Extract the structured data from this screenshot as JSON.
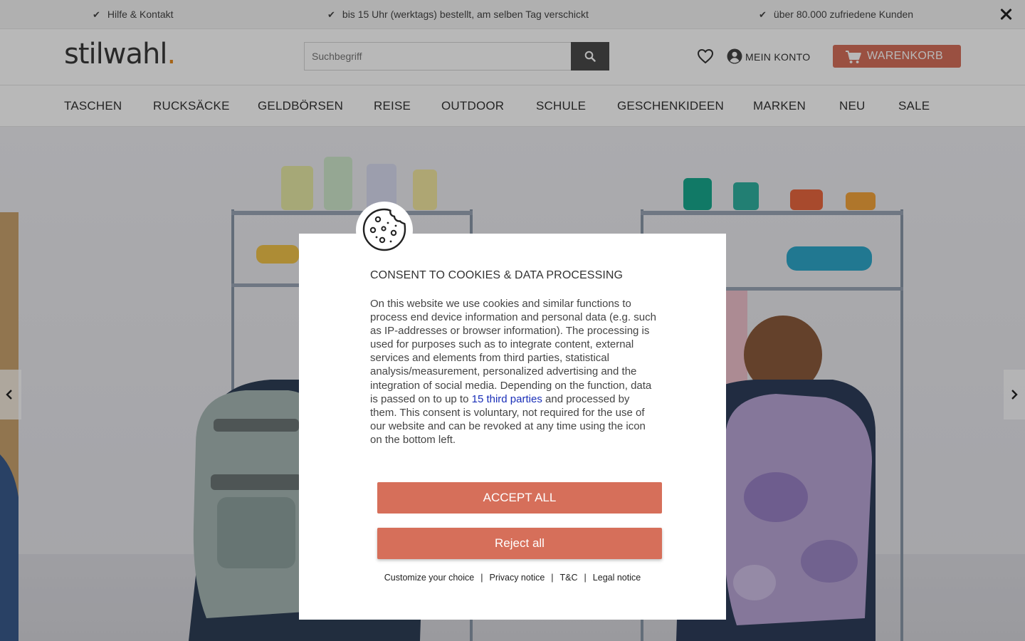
{
  "topbar": {
    "usps": [
      {
        "check": "✔",
        "text": "Hilfe & Kontakt"
      },
      {
        "check": "✔",
        "text": "bis 15 Uhr (werktags) bestellt, am selben Tag verschickt"
      },
      {
        "check": "✔",
        "text": "über 80.000 zufriedene Kunden"
      }
    ]
  },
  "header": {
    "logo_text": "stilwahl",
    "logo_dot": ".",
    "search_placeholder": "Suchbegriff",
    "account_label": "MEIN KONTO",
    "cart_label": "WARENKORB"
  },
  "nav": {
    "items": [
      "TASCHEN",
      "RUCKSÄCKE",
      "GELDBÖRSEN",
      "REISE",
      "OUTDOOR",
      "SCHULE",
      "GESCHENKIDEEN",
      "MARKEN",
      "NEU",
      "SALE"
    ]
  },
  "consent": {
    "title": "CONSENT TO COOKIES & DATA PROCESSING",
    "body_before_link": "On this website we use cookies and similar functions to process end device information and personal data (e.g. such as IP-addresses or browser information). The processing is used for purposes such as to integrate content, external services and elements from third parties, statistical analysis/measurement, personalized advertising and the integration of social media. Depending on the function, data is passed on to up to ",
    "body_link": "15 third parties",
    "body_after_link": " and processed by them. This consent is voluntary, not required for the use of our website and can be revoked at any time using the icon on the bottom left.",
    "accept_label": "ACCEPT ALL",
    "reject_label": "Reject all",
    "links": [
      "Customize your choice",
      "Privacy notice",
      "T&C",
      "Legal notice"
    ],
    "separator": "|"
  },
  "colors": {
    "accent": "#d66f5a",
    "logo_dot": "#e5891e",
    "link": "#1a2fb8"
  }
}
